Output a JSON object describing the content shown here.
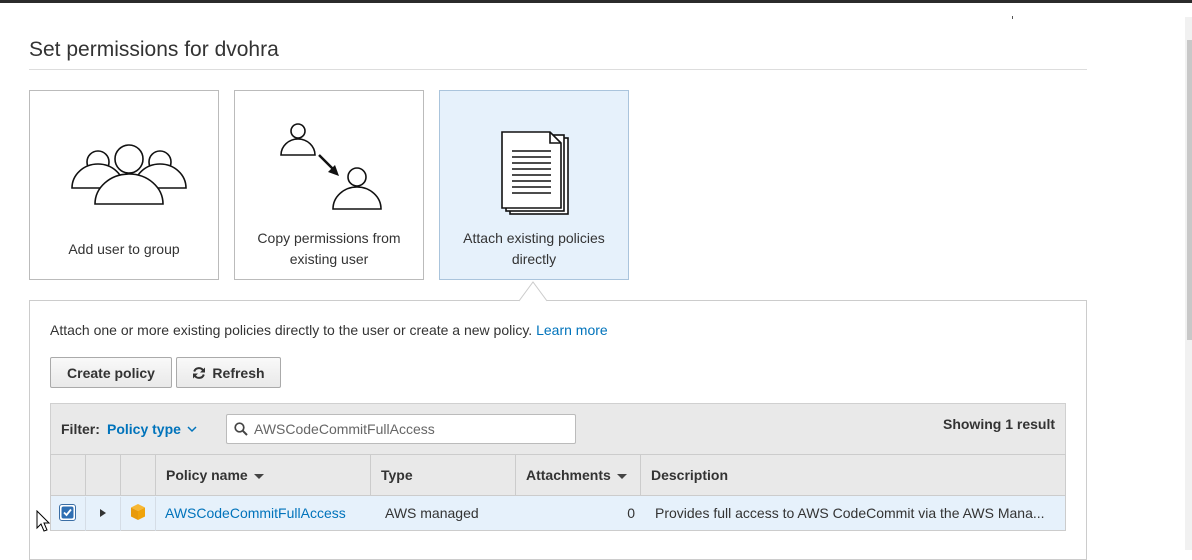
{
  "page": {
    "title": "Set permissions for dvohra"
  },
  "options": [
    {
      "label": "Add user to group",
      "icon": "user-group-icon"
    },
    {
      "label": "Copy permissions from existing user",
      "icon": "copy-permissions-icon"
    },
    {
      "label": "Attach existing policies directly",
      "icon": "document-stack-icon",
      "selected": true
    }
  ],
  "panel": {
    "intro": "Attach one or more existing policies directly to the user or create a new policy.",
    "learn_more": "Learn more"
  },
  "toolbar": {
    "create_policy": "Create policy",
    "refresh": "Refresh"
  },
  "filter": {
    "label": "Filter:",
    "select_value": "Policy type",
    "search_value": "AWSCodeCommitFullAccess",
    "showing": "Showing 1 result"
  },
  "table": {
    "headers": {
      "policy_name": "Policy name",
      "type": "Type",
      "attachments": "Attachments",
      "description": "Description"
    },
    "rows": [
      {
        "checked": true,
        "policy_name": "AWSCodeCommitFullAccess",
        "type": "AWS managed",
        "attachments": "0",
        "description": "Provides full access to AWS CodeCommit via the AWS Mana..."
      }
    ]
  },
  "colors": {
    "accent": "#0073bb",
    "selected_bg": "#e6f1fb",
    "policy_icon": "#f0a30a"
  }
}
